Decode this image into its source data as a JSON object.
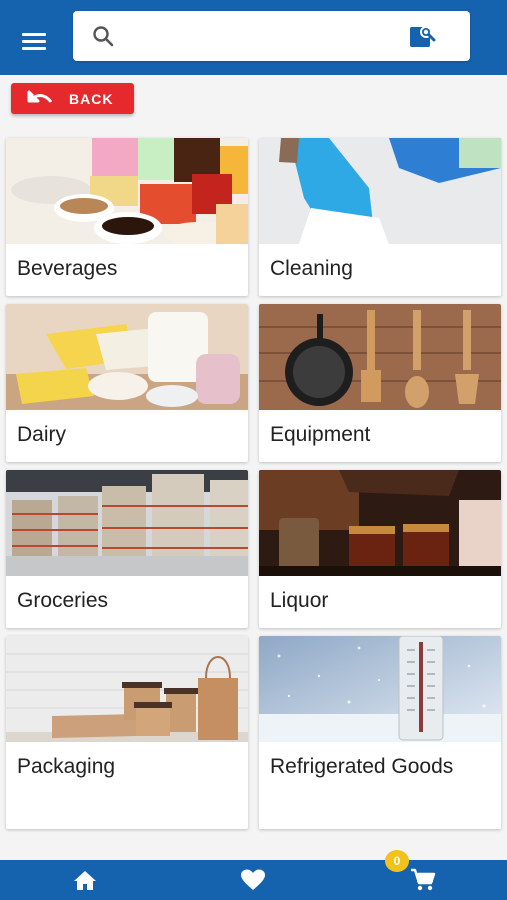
{
  "header": {
    "search_placeholder": ""
  },
  "back_button": {
    "label": "BACK"
  },
  "categories": [
    {
      "label": "Beverages"
    },
    {
      "label": "Cleaning"
    },
    {
      "label": "Dairy"
    },
    {
      "label": "Equipment"
    },
    {
      "label": "Groceries"
    },
    {
      "label": "Liquor"
    },
    {
      "label": "Packaging"
    },
    {
      "label": "Refrigerated Goods"
    }
  ],
  "footer": {
    "cart_count": "0"
  },
  "colors": {
    "primary": "#1562ae",
    "back": "#e5292d",
    "badge": "#f2c21a"
  }
}
